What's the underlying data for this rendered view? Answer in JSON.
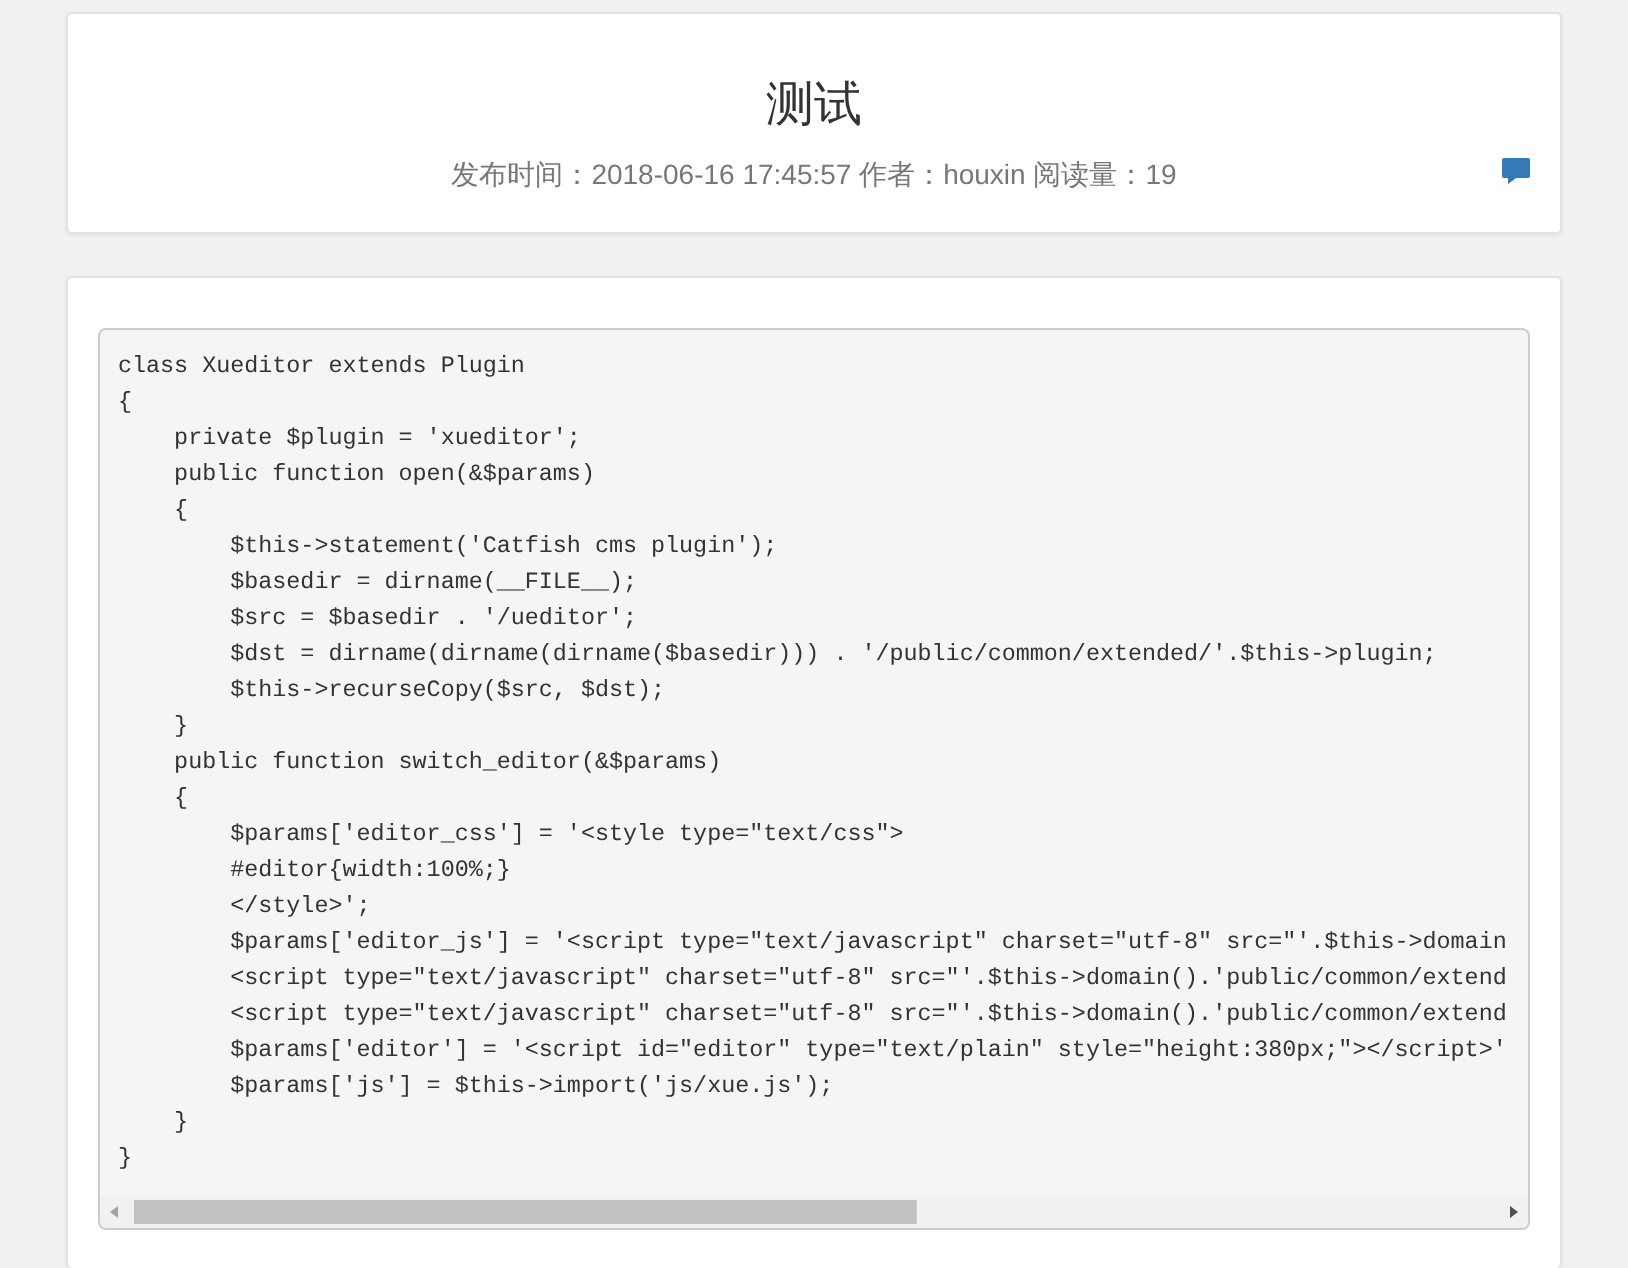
{
  "article": {
    "title": "测试",
    "meta": "发布时间：2018-06-16 17:45:57 作者：houxin 阅读量：19"
  },
  "code": {
    "lines": [
      "class Xueditor extends Plugin",
      "{",
      "    private $plugin = 'xueditor';",
      "    public function open(&$params)",
      "    {",
      "        $this->statement('Catfish cms plugin');",
      "        $basedir = dirname(__FILE__);",
      "        $src = $basedir . '/ueditor';",
      "        $dst = dirname(dirname(dirname($basedir))) . '/public/common/extended/'.$this->plugin;",
      "        $this->recurseCopy($src, $dst);",
      "    }",
      "    public function switch_editor(&$params)",
      "    {",
      "        $params['editor_css'] = '<style type=\"text/css\">",
      "        #editor{width:100%;}",
      "        </style>';",
      "        $params['editor_js'] = '<script type=\"text/javascript\" charset=\"utf-8\" src=\"'.$this->domain",
      "        <script type=\"text/javascript\" charset=\"utf-8\" src=\"'.$this->domain().'public/common/extend",
      "        <script type=\"text/javascript\" charset=\"utf-8\" src=\"'.$this->domain().'public/common/extend",
      "        $params['editor'] = '<script id=\"editor\" type=\"text/plain\" style=\"height:380px;\"></script>'",
      "        $params['js'] = $this->import('js/xue.js');",
      "    }",
      "}"
    ]
  }
}
